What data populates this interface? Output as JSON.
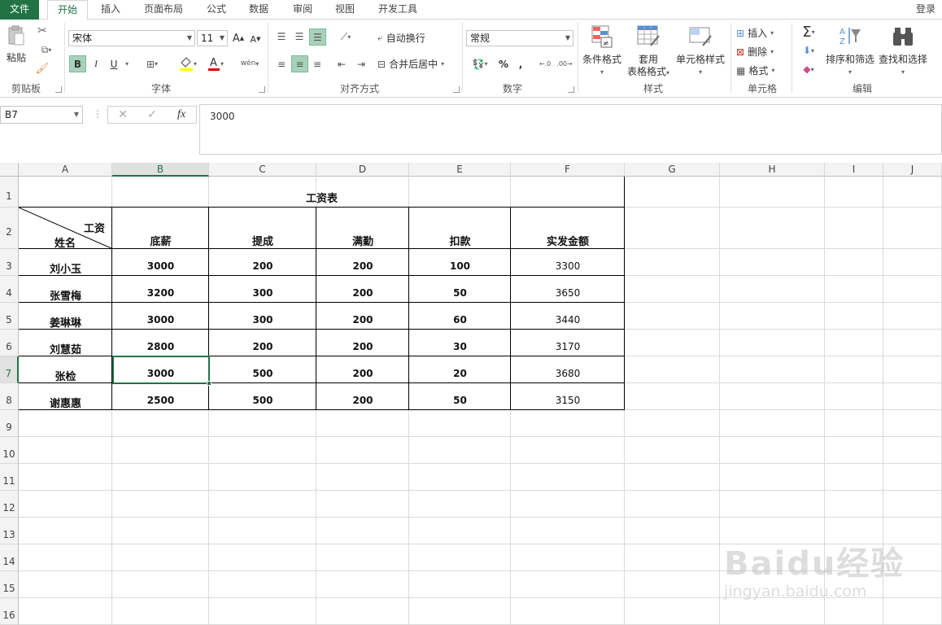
{
  "tabs": {
    "file": "文件",
    "items": [
      "开始",
      "插入",
      "页面布局",
      "公式",
      "数据",
      "审阅",
      "视图",
      "开发工具"
    ],
    "login": "登录"
  },
  "ribbon": {
    "clipboard": {
      "paste": "粘贴",
      "label": "剪贴板"
    },
    "font": {
      "name": "宋体",
      "size": "11",
      "bold": "B",
      "italic": "I",
      "underline": "U",
      "label": "字体"
    },
    "align": {
      "wrap": "自动换行",
      "merge": "合并后居中",
      "label": "对齐方式"
    },
    "number": {
      "format": "常规",
      "percent": "%",
      "comma": ",",
      "label": "数字"
    },
    "styles": {
      "conditional": "条件格式",
      "table1": "套用",
      "table2": "表格格式",
      "cell": "单元格样式",
      "label": "样式"
    },
    "cells": {
      "insert": "插入",
      "delete": "删除",
      "format": "格式",
      "label": "单元格"
    },
    "editing": {
      "sort": "排序和筛选",
      "find": "查找和选择",
      "label": "编辑"
    }
  },
  "formula_bar": {
    "name_box": "B7",
    "fx": "fx",
    "value": "3000"
  },
  "columns": [
    "A",
    "B",
    "C",
    "D",
    "E",
    "F",
    "G",
    "H",
    "I",
    "J"
  ],
  "rows": [
    "1",
    "2",
    "3",
    "4",
    "5",
    "6",
    "7",
    "8",
    "9",
    "10",
    "11",
    "12",
    "13",
    "14",
    "15",
    "16"
  ],
  "sheet": {
    "title": "工资表",
    "corner_top": "工资",
    "corner_bottom": "姓名",
    "headers": [
      "底薪",
      "提成",
      "满勤",
      "扣款",
      "实发金额"
    ],
    "data": [
      [
        "刘小玉",
        "3000",
        "200",
        "200",
        "100",
        "3300"
      ],
      [
        "张雪梅",
        "3200",
        "300",
        "200",
        "50",
        "3650"
      ],
      [
        "姜琳琳",
        "3000",
        "300",
        "200",
        "60",
        "3440"
      ],
      [
        "刘慧茹",
        "2800",
        "200",
        "200",
        "30",
        "3170"
      ],
      [
        "张检",
        "3000",
        "500",
        "200",
        "20",
        "3680"
      ],
      [
        "谢惠惠",
        "2500",
        "500",
        "200",
        "50",
        "3150"
      ]
    ]
  },
  "watermark": {
    "brand": "Baidu经验",
    "url": "jingyan.baidu.com"
  },
  "colors": {
    "accent": "#217346",
    "selected_button": "#a7d2b9"
  }
}
